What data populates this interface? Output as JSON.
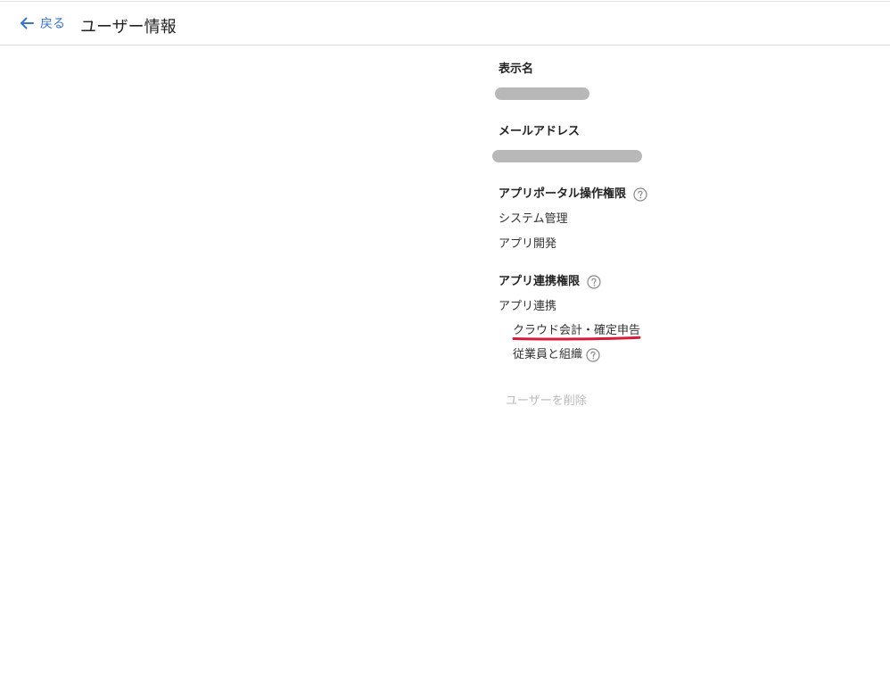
{
  "header": {
    "back_label": "戻る",
    "title": "ユーザー情報"
  },
  "display_name": {
    "label": "表示名"
  },
  "email": {
    "label": "メールアドレス"
  },
  "app_portal": {
    "label": "アプリポータル操作権限",
    "items": [
      "システム管理",
      "アプリ開発"
    ]
  },
  "app_integration": {
    "label": "アプリ連携権限",
    "item": "アプリ連携",
    "subitems": [
      "クラウド会計・確定申告",
      "従業員と組織"
    ]
  },
  "actions": {
    "delete_label": "ユーザーを削除"
  },
  "colors": {
    "accent": "#3b73c7",
    "annotation": "#d81b3b",
    "disabled": "#b9b9b9"
  }
}
